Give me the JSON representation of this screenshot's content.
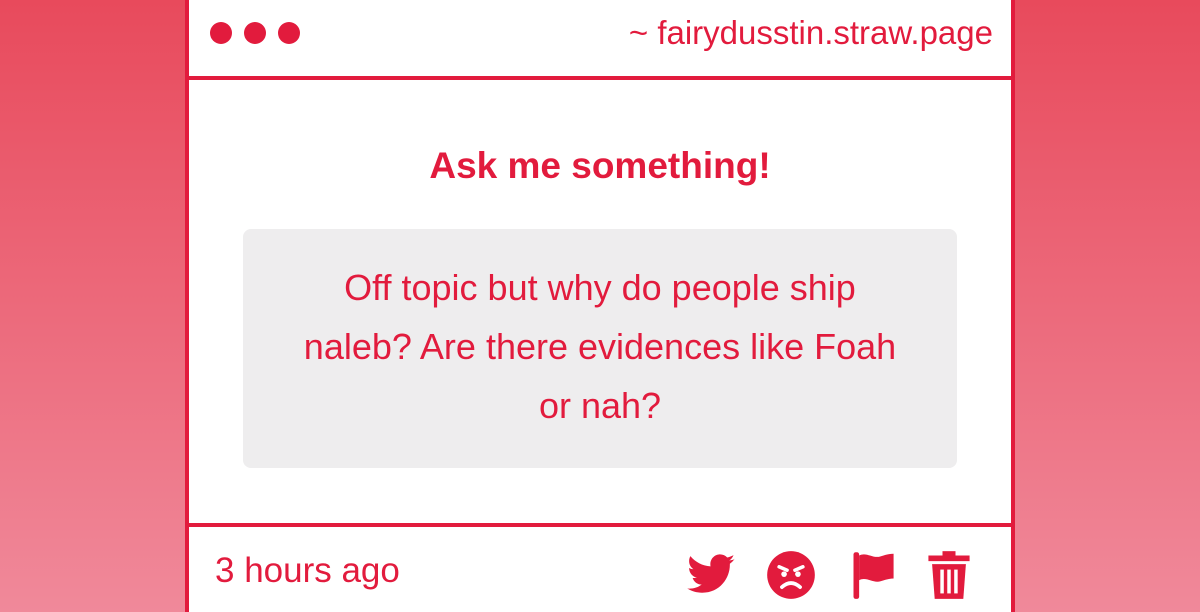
{
  "header": {
    "url": "~ fairydusstin.straw.page"
  },
  "main": {
    "heading": "Ask me something!",
    "question": "Off topic but why do people ship naleb? Are there evidences like Foah or nah?"
  },
  "footer": {
    "timestamp": "3 hours ago",
    "actions": [
      "twitter-icon",
      "angry-face-icon",
      "flag-icon",
      "trash-icon"
    ]
  },
  "colors": {
    "accent": "#e21b3d",
    "background_top": "#e84a5c",
    "background_bottom": "#f0899a",
    "question_box": "#eeedee"
  }
}
